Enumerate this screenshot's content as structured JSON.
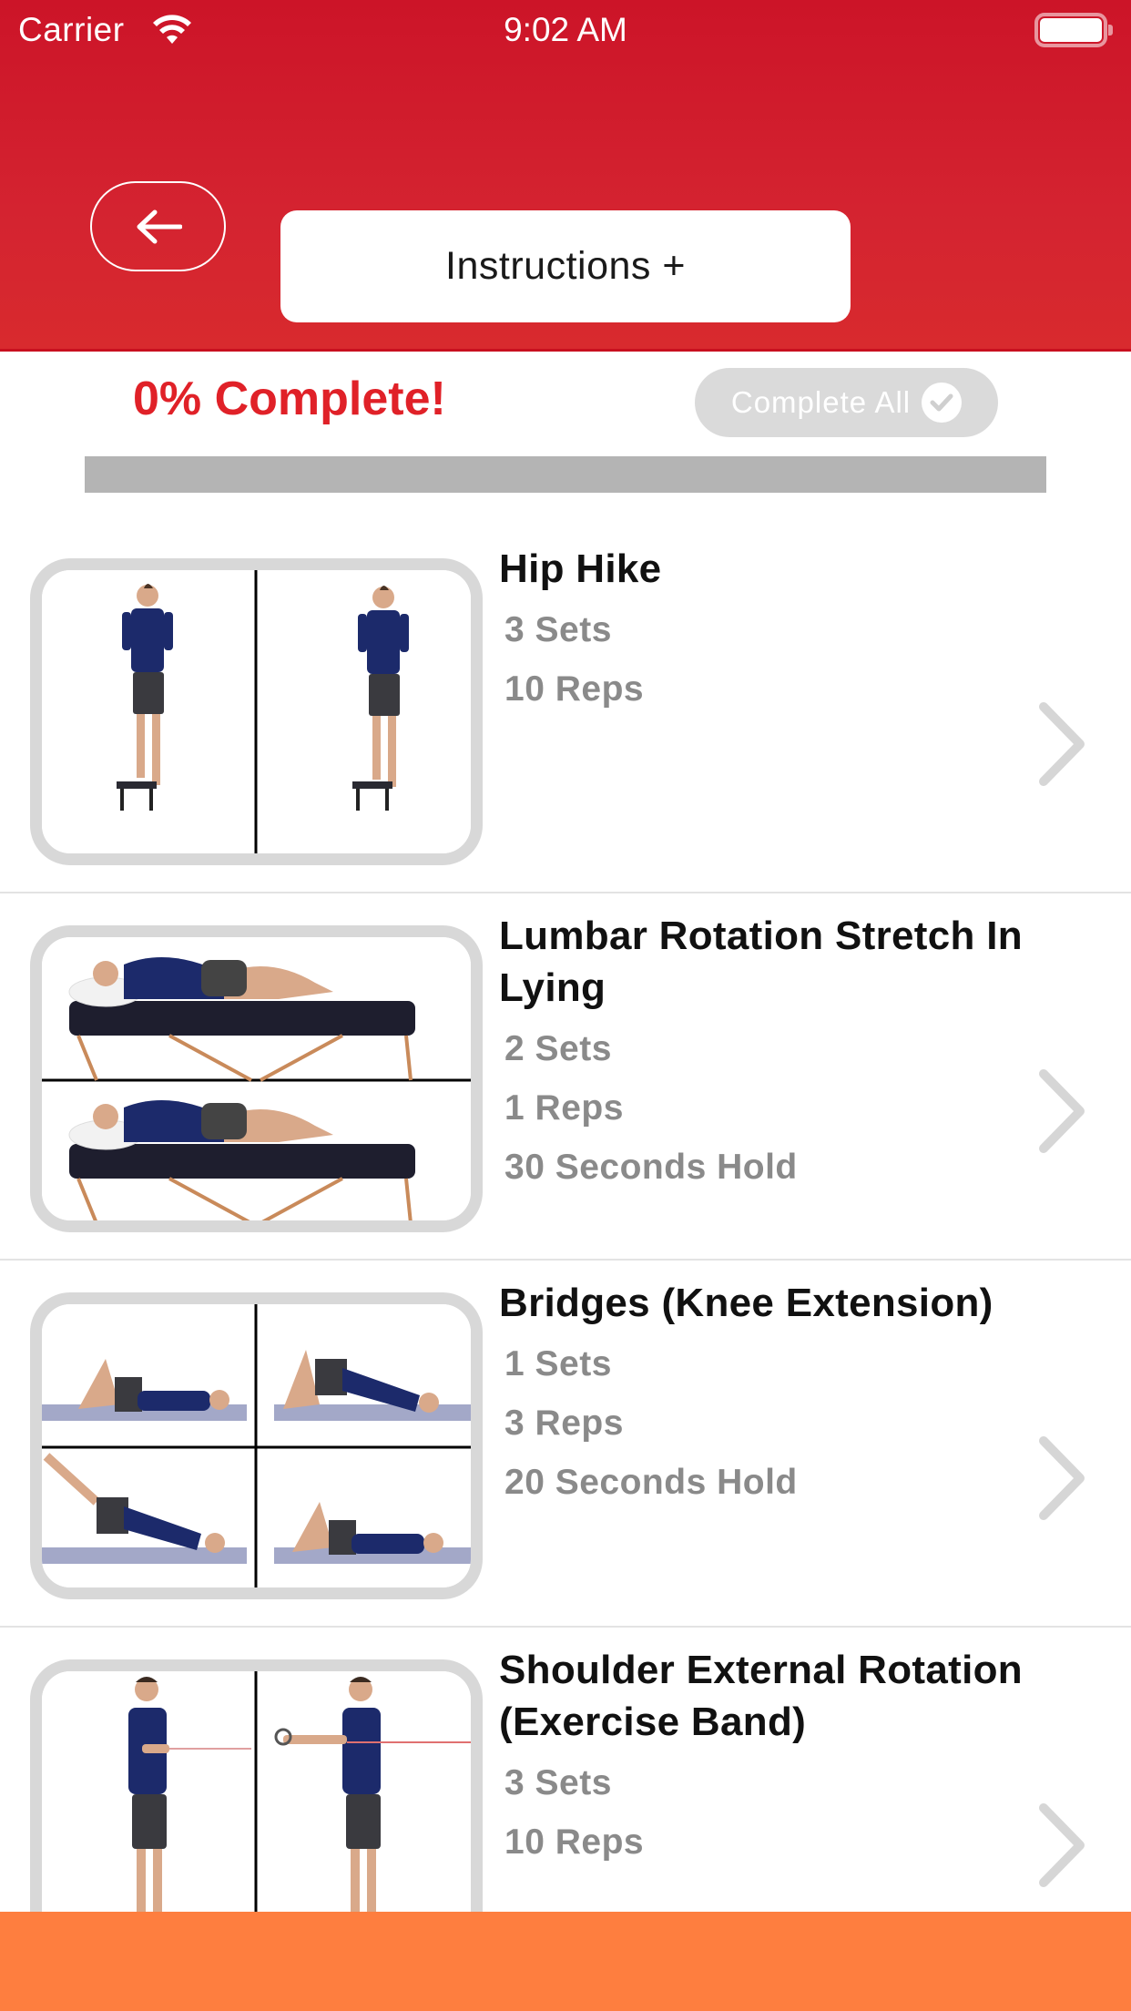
{
  "status_bar": {
    "carrier": "Carrier",
    "time": "9:02 AM",
    "wifi_icon": "wifi-icon",
    "battery_icon": "battery-icon",
    "battery_level": 1.0
  },
  "header": {
    "back_icon": "arrow-left-icon",
    "instructions_label": "Instructions +",
    "colors": {
      "primary": "#d42330",
      "button_bg": "#ffffff"
    }
  },
  "progress": {
    "label": "0% Complete!",
    "percent": 0,
    "complete_all_label": "Complete All",
    "complete_all_icon": "check-circle-icon",
    "colors": {
      "label": "#e02128",
      "track": "#b4b4b4",
      "button_bg": "#dadada"
    }
  },
  "exercises": [
    {
      "title": "Hip Hike",
      "details": [
        "3 Sets",
        "10 Reps"
      ],
      "thumbnail": "hip-hike-thumbnail",
      "layout": "2-col"
    },
    {
      "title": "Lumbar Rotation Stretch In Lying",
      "details": [
        "2 Sets",
        "1 Reps",
        "30 Seconds Hold"
      ],
      "thumbnail": "lumbar-rotation-thumbnail",
      "layout": "2-row"
    },
    {
      "title": "Bridges (Knee Extension)",
      "details": [
        "1 Sets",
        "3 Reps",
        "20 Seconds Hold"
      ],
      "thumbnail": "bridges-thumbnail",
      "layout": "2x2"
    },
    {
      "title": "Shoulder External Rotation (Exercise Band)",
      "details": [
        "3 Sets",
        "10 Reps"
      ],
      "thumbnail": "shoulder-rotation-thumbnail",
      "layout": "2-col"
    }
  ],
  "bottom_bar": {
    "color": "#fe7e3f"
  }
}
